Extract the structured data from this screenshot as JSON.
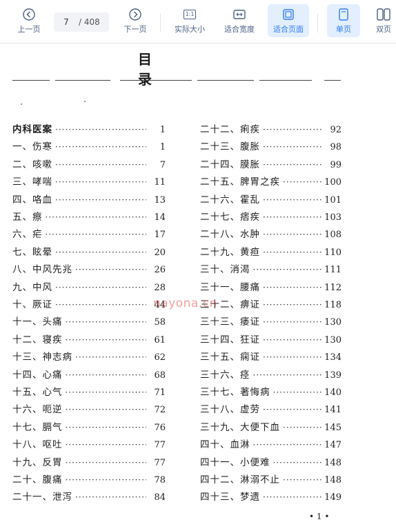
{
  "toolbar": {
    "prev_label": "上一页",
    "next_label": "下一页",
    "page_current": "7",
    "page_total": "/ 408",
    "actual_size_label": "实际大小",
    "actual_size_icon_text": "1:1",
    "fit_width_label": "适合宽度",
    "fit_page_label": "适合页面",
    "single_page_label": "单页",
    "double_page_label": "双页",
    "accent": "#2f7bf5",
    "active_bg": "#e3efff"
  },
  "document": {
    "title": "目录",
    "watermark": "nayona.cn",
    "page_number": "• 1 •",
    "left_entries": [
      {
        "title": "内科医案",
        "page": "1",
        "head": true
      },
      {
        "title": "一、伤寒",
        "page": "1"
      },
      {
        "title": "二、咳嗽",
        "page": "7"
      },
      {
        "title": "三、哮喘",
        "page": "11"
      },
      {
        "title": "四、咯血",
        "page": "13"
      },
      {
        "title": "五、瘵",
        "page": "14"
      },
      {
        "title": "六、疟",
        "page": "17"
      },
      {
        "title": "七、眩晕",
        "page": "20"
      },
      {
        "title": "八、中风先兆",
        "page": "26"
      },
      {
        "title": "九、中风",
        "page": "28"
      },
      {
        "title": "十、厥证",
        "page": "44"
      },
      {
        "title": "十一、头痛",
        "page": "58"
      },
      {
        "title": "十二、寝疾",
        "page": "61"
      },
      {
        "title": "十三、神志病",
        "page": "62"
      },
      {
        "title": "十四、心痛",
        "page": "68"
      },
      {
        "title": "十五、心气",
        "page": "71"
      },
      {
        "title": "十六、呃逆",
        "page": "72"
      },
      {
        "title": "十七、膈气",
        "page": "76"
      },
      {
        "title": "十八、呕吐",
        "page": "77"
      },
      {
        "title": "十九、反胃",
        "page": "77"
      },
      {
        "title": "二十、腹痛",
        "page": "78"
      },
      {
        "title": "二十一、泄泻",
        "page": "84"
      }
    ],
    "right_entries": [
      {
        "title": "二十二、痢疾",
        "page": "92"
      },
      {
        "title": "二十三、腹胀",
        "page": "98"
      },
      {
        "title": "二十四、膜胀",
        "page": "99"
      },
      {
        "title": "二十五、脾胃之疾",
        "page": "100"
      },
      {
        "title": "二十六、霍乱",
        "page": "101"
      },
      {
        "title": "二十七、痞疾",
        "page": "103"
      },
      {
        "title": "二十八、水肿",
        "page": "108"
      },
      {
        "title": "二十九、黄疸",
        "page": "110"
      },
      {
        "title": "三十、消渴",
        "page": "111"
      },
      {
        "title": "三十一、腰痛",
        "page": "112"
      },
      {
        "title": "三十二、痹证",
        "page": "118"
      },
      {
        "title": "三十三、痿证",
        "page": "130"
      },
      {
        "title": "三十四、狂证",
        "page": "130"
      },
      {
        "title": "三十五、痫证",
        "page": "134"
      },
      {
        "title": "三十六、痉",
        "page": "139"
      },
      {
        "title": "三十七、著悔病",
        "page": "140"
      },
      {
        "title": "三十八、虚劳",
        "page": "141"
      },
      {
        "title": "三十九、大便下血",
        "page": "145"
      },
      {
        "title": "四十、血淋",
        "page": "147"
      },
      {
        "title": "四十一、小便难",
        "page": "148"
      },
      {
        "title": "四十二、淋溺不止",
        "page": "148"
      },
      {
        "title": "四十三、梦遗",
        "page": "149"
      }
    ]
  }
}
